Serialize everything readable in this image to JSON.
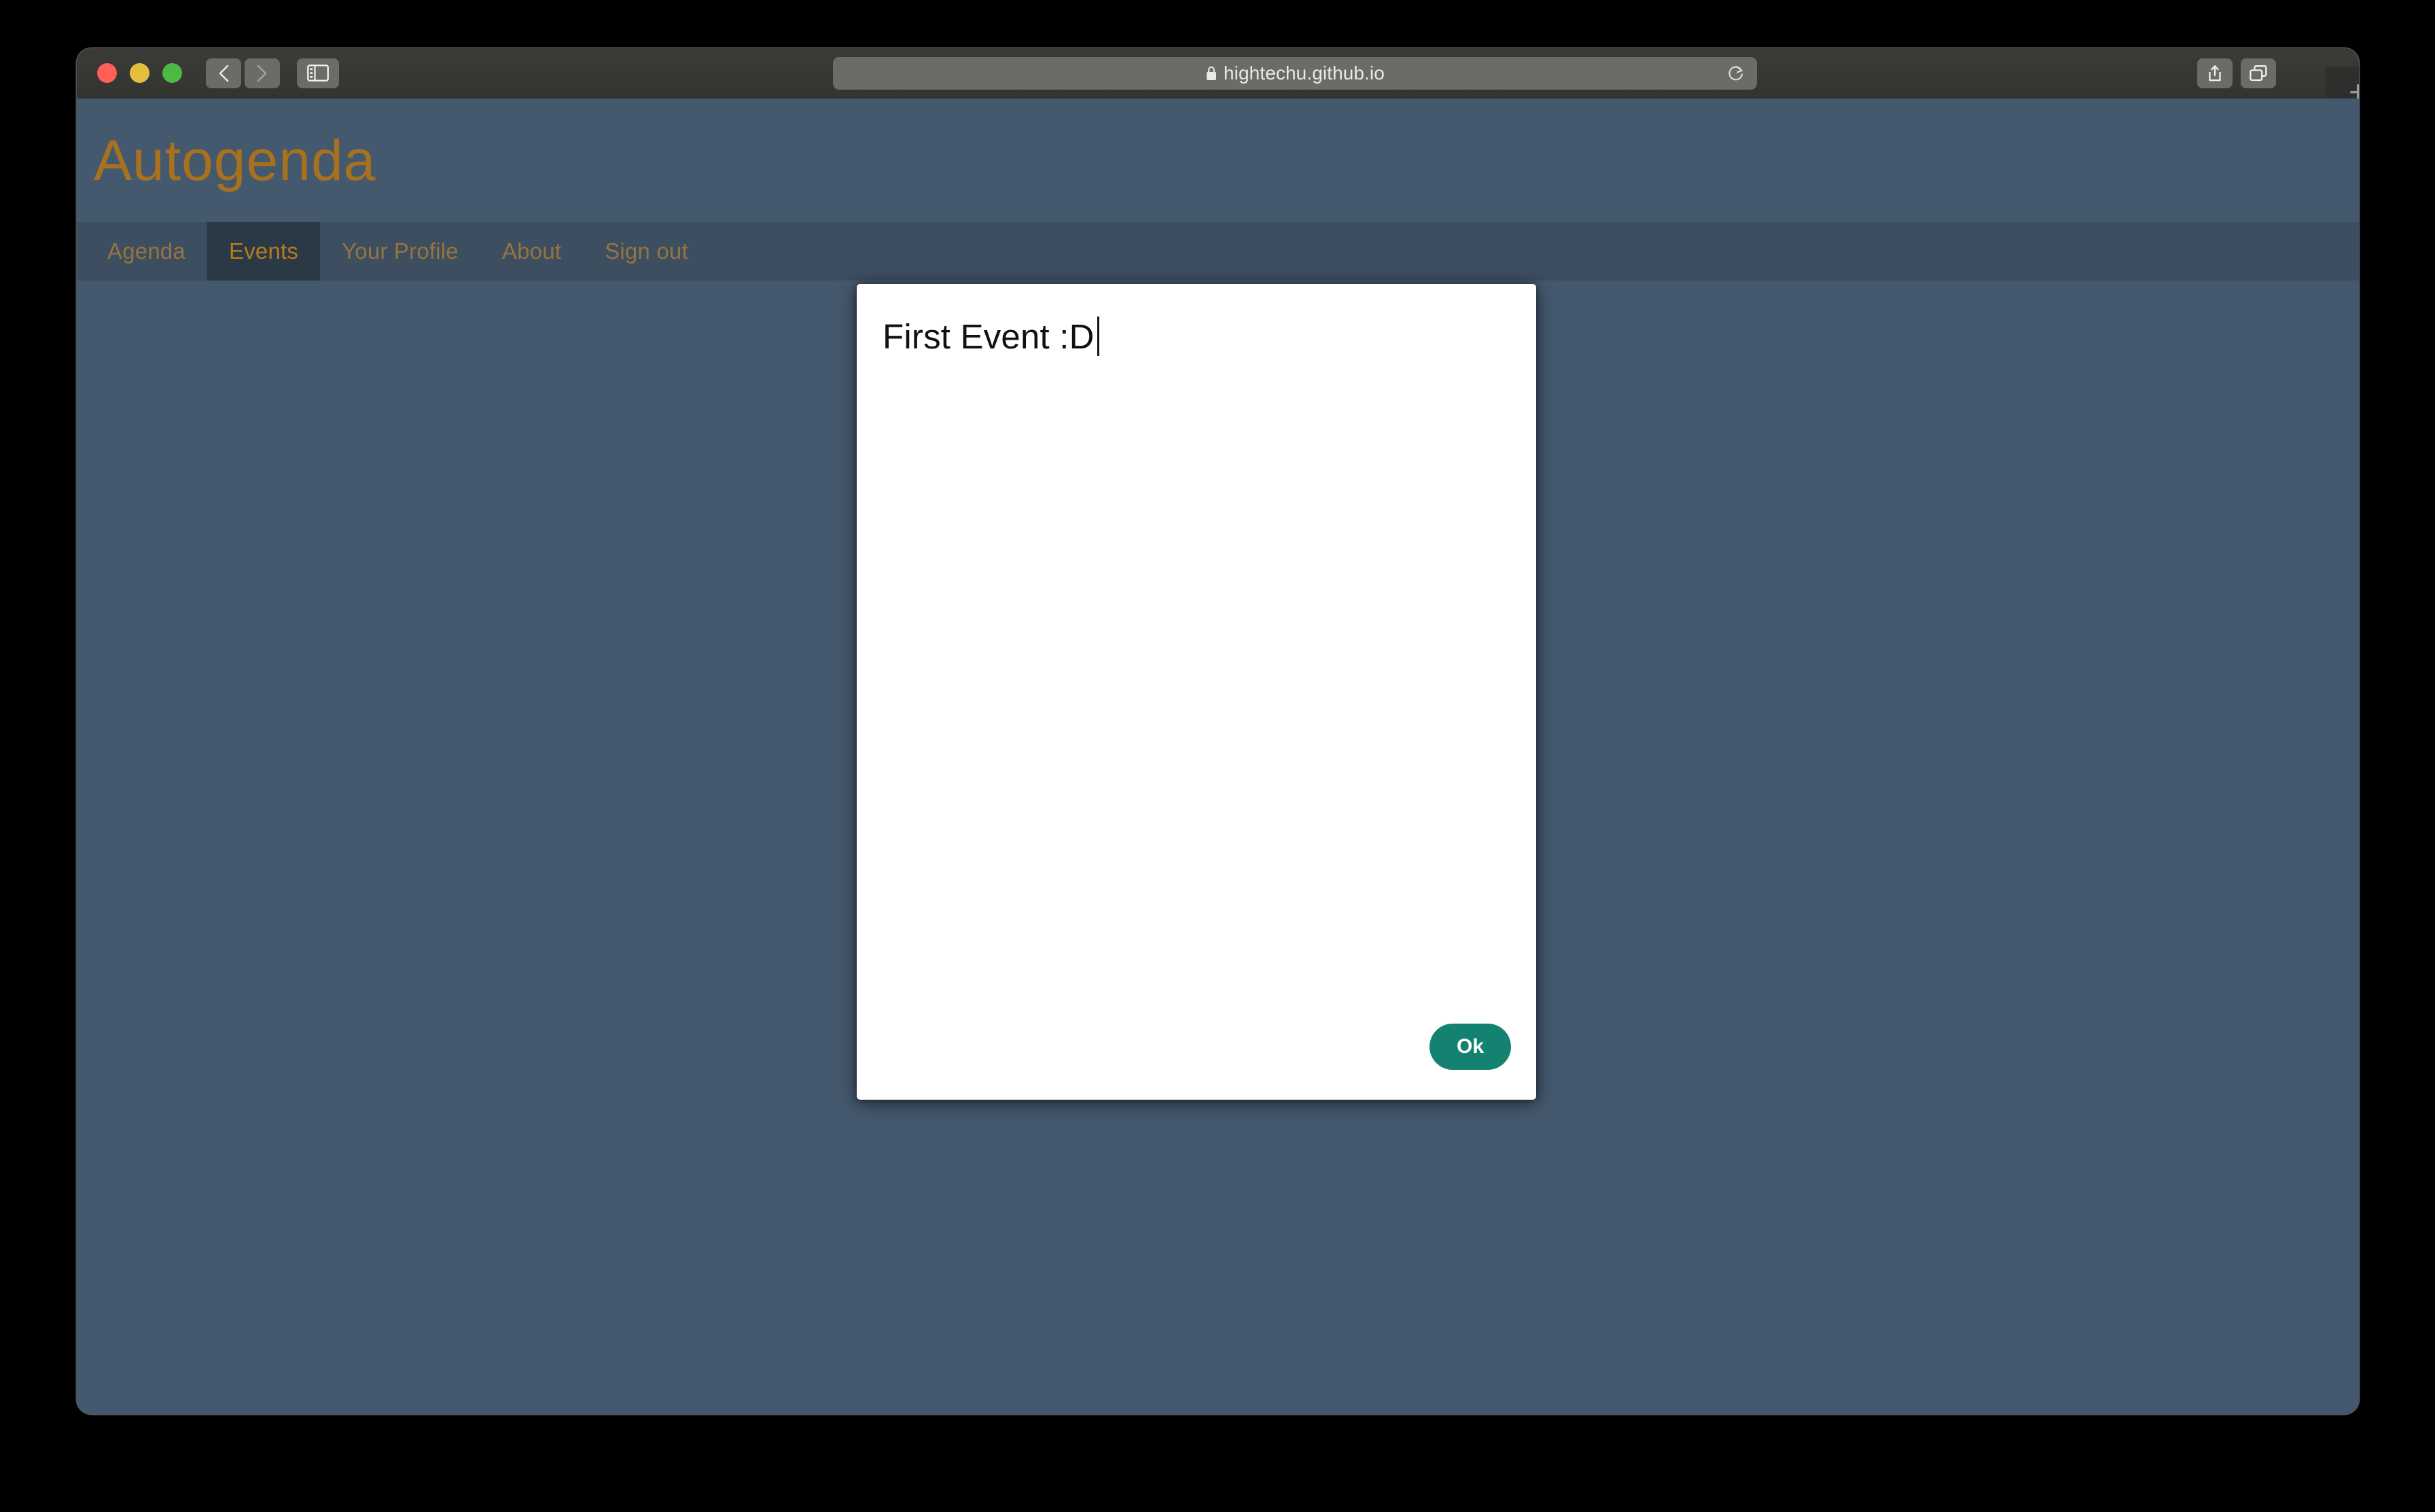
{
  "browser": {
    "name": "Safari",
    "traffic_lights": [
      {
        "name": "close",
        "color": "#ff5f57"
      },
      {
        "name": "minimize",
        "color": "#e3bf40"
      },
      {
        "name": "maximize",
        "color": "#4cb944"
      }
    ],
    "back_button_icon": "chevron-left-icon",
    "forward_button_icon": "chevron-right-icon",
    "sidebar_button_icon": "sidebar-icon",
    "url": "hightechu.github.io",
    "lock_icon": "lock-icon",
    "reload_icon": "reload-icon",
    "share_icon": "share-icon",
    "tabs_icon": "tab-overview-icon",
    "new_tab_label": "+"
  },
  "site": {
    "title": "Autogenda",
    "title_color": "#a8711d",
    "header_bg": "#45596e",
    "nav_bg": "#3c4e60",
    "nav_active_bg": "#2b3845",
    "nav_active_color": "#b57d1c",
    "nav_inactive_color": "#96743f"
  },
  "nav": {
    "items": [
      {
        "label": "Agenda",
        "active": false
      },
      {
        "label": "Events",
        "active": true
      },
      {
        "label": "Your Profile",
        "active": false
      },
      {
        "label": "About",
        "active": false
      },
      {
        "label": "Sign out",
        "active": false
      }
    ]
  },
  "dialog": {
    "title_value": "First Event :D",
    "title_placeholder": "",
    "ok_label": "Ok",
    "ok_color": "#148271",
    "background": "#ffffff"
  }
}
